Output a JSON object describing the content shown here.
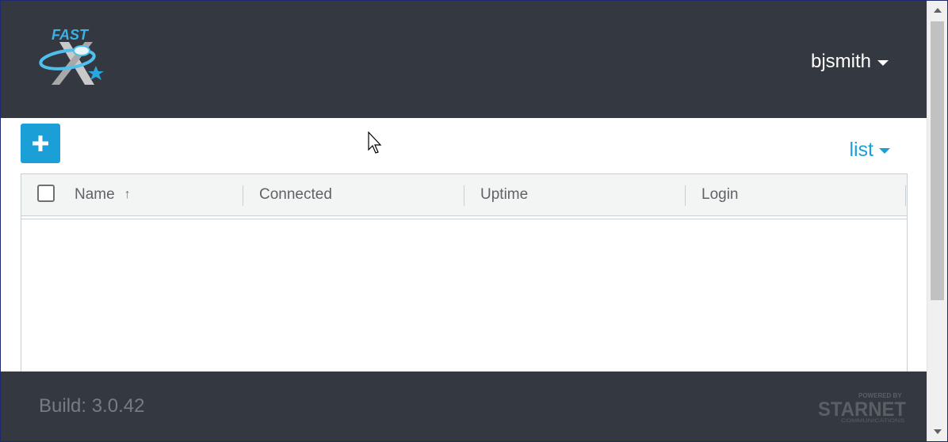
{
  "header": {
    "logo_text": "FAST",
    "username": "bjsmith"
  },
  "toolbar": {
    "add_symbol": "+",
    "view_label": "list"
  },
  "table": {
    "columns": [
      {
        "label": "Name",
        "sort": "ascending"
      },
      {
        "label": "Connected"
      },
      {
        "label": "Uptime"
      },
      {
        "label": "Login"
      }
    ],
    "sort_symbol": "↑",
    "rows": []
  },
  "footer": {
    "build_text": "Build: 3.0.42",
    "brand_text": "STARNET",
    "brand_tagline": "POWERED BY",
    "brand_subtext": "COMMUNICATIONS"
  },
  "colors": {
    "header_bg": "#343840",
    "accent": "#1a9fd6",
    "footer_text": "#777c82"
  }
}
